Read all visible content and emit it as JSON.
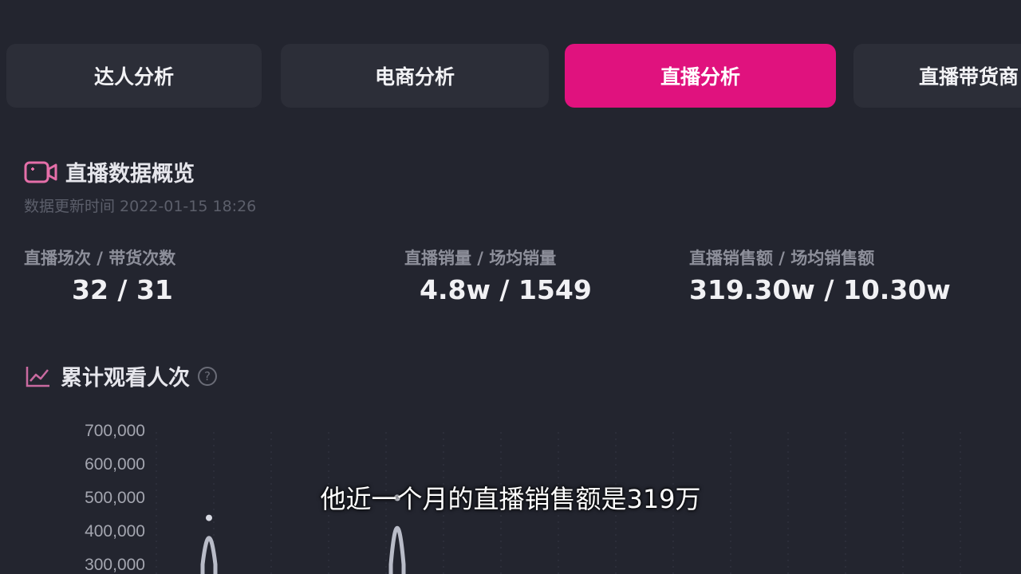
{
  "tabs": [
    {
      "label": "达人分析",
      "active": false
    },
    {
      "label": "电商分析",
      "active": false
    },
    {
      "label": "直播分析",
      "active": true
    },
    {
      "label": "直播带货商",
      "active": false
    }
  ],
  "overview": {
    "title": "直播数据概览",
    "update_time": "数据更新时间 2022-01-15 18:26",
    "stats": [
      {
        "label": "直播场次 / 带货次数",
        "value": "32 / 31"
      },
      {
        "label": "直播销量 / 场均销量",
        "value": "4.8w / 1549"
      },
      {
        "label": "直播销售额 / 场均销售额",
        "value": "319.30w / 10.30w"
      }
    ]
  },
  "views": {
    "title": "累计观看人次",
    "help": "?"
  },
  "chart_data": {
    "type": "line",
    "title": "累计观看人次",
    "y_ticks": [
      "700,000",
      "600,000",
      "500,000",
      "400,000",
      "300,000"
    ],
    "ylim": [
      300000,
      700000
    ],
    "grid": true,
    "series": [
      {
        "values": [
          300000,
          420000,
          300000
        ]
      },
      {
        "values": [
          300000,
          480000,
          300000
        ]
      }
    ]
  },
  "caption": "他近一个月的直播销售额是319万",
  "colors": {
    "background": "#23252f",
    "tab": "#2c2e38",
    "accent": "#e0127e"
  }
}
